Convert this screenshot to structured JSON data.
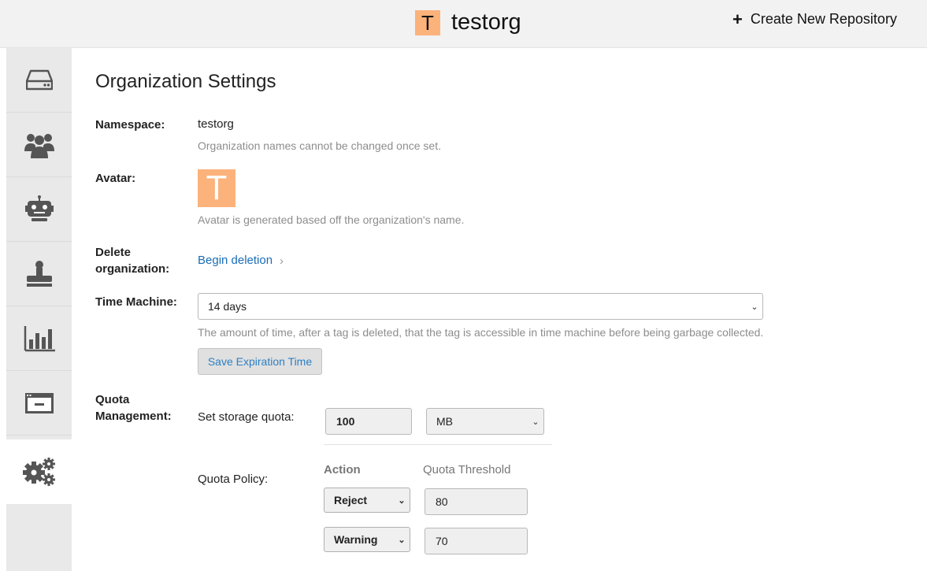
{
  "header": {
    "org_initial": "T",
    "org_name": "testorg",
    "create_repo_label": "Create New Repository"
  },
  "sidebar": {
    "items": [
      {
        "icon": "repository-drive-icon"
      },
      {
        "icon": "teams-users-icon"
      },
      {
        "icon": "robot-accounts-icon"
      },
      {
        "icon": "default-permissions-stamp-icon"
      },
      {
        "icon": "usage-logs-chart-icon"
      },
      {
        "icon": "applications-window-icon"
      },
      {
        "icon": "settings-gears-icon",
        "active": true
      }
    ]
  },
  "main": {
    "title": "Organization Settings",
    "namespace": {
      "label": "Namespace:",
      "value": "testorg",
      "help": "Organization names cannot be changed once set."
    },
    "avatar": {
      "label": "Avatar:",
      "initial": "T",
      "help": "Avatar is generated based off the organization's name."
    },
    "delete": {
      "label_line1": "Delete",
      "label_line2": "organization:",
      "link": "Begin deletion",
      "chevron": "›"
    },
    "time_machine": {
      "label": "Time Machine:",
      "selected": "14 days",
      "help": "The amount of time, after a tag is deleted, that the tag is accessible in time machine before being garbage collected.",
      "save_label": "Save Expiration Time"
    },
    "quota": {
      "label_line1": "Quota",
      "label_line2": "Management:",
      "storage_label": "Set storage quota:",
      "storage_value": "100",
      "unit": "MB",
      "policy_label": "Quota Policy:",
      "action_header": "Action",
      "threshold_header": "Quota Threshold",
      "rows": [
        {
          "action": "Reject",
          "threshold": "80"
        },
        {
          "action": "Warning",
          "threshold": "70"
        }
      ]
    }
  },
  "colors": {
    "avatar_bg": "#fcb27b",
    "link": "#1a6db6",
    "sidebar_bg": "#e9e9e9"
  }
}
